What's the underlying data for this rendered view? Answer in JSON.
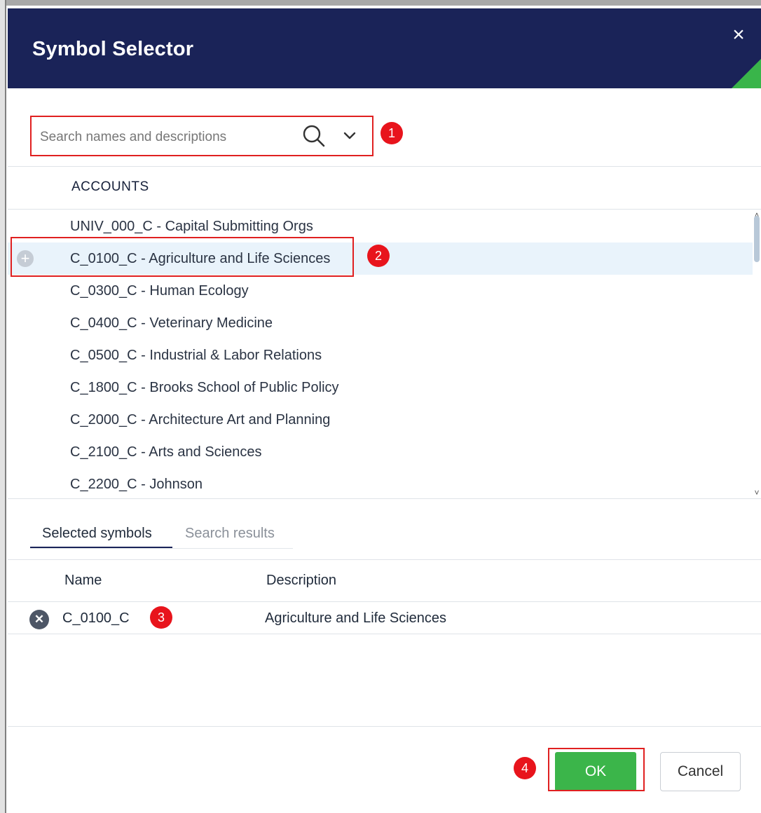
{
  "dialog": {
    "title": "Symbol Selector",
    "close_label": "×"
  },
  "search": {
    "placeholder": "Search names and descriptions",
    "value": "",
    "search_icon": "search-icon",
    "dropdown_icon": "chevron-down-icon"
  },
  "annotations": {
    "step1": "1",
    "step2": "2",
    "step3": "3",
    "step4": "4"
  },
  "symbol_list": {
    "heading": "ACCOUNTS",
    "items": [
      {
        "label": "UNIV_000_C - Capital Submitting Orgs",
        "selected": false
      },
      {
        "label": "C_0100_C - Agriculture and Life Sciences",
        "selected": true
      },
      {
        "label": "C_0300_C - Human Ecology",
        "selected": false
      },
      {
        "label": "C_0400_C - Veterinary Medicine",
        "selected": false
      },
      {
        "label": "C_0500_C - Industrial & Labor Relations",
        "selected": false
      },
      {
        "label": "C_1800_C - Brooks School of Public Policy",
        "selected": false
      },
      {
        "label": "C_2000_C - Architecture Art and Planning",
        "selected": false
      },
      {
        "label": "C_2100_C - Arts and Sciences",
        "selected": false
      },
      {
        "label": "C_2200_C - Johnson",
        "selected": false
      }
    ]
  },
  "tabs": {
    "selected_symbols": "Selected symbols",
    "search_results": "Search results",
    "active": "selected_symbols"
  },
  "selected_table": {
    "columns": {
      "name": "Name",
      "description": "Description"
    },
    "rows": [
      {
        "name": "C_0100_C",
        "description": "Agriculture and Life Sciences"
      }
    ]
  },
  "footer": {
    "ok_label": "OK",
    "cancel_label": "Cancel"
  },
  "colors": {
    "header_bg": "#1a2358",
    "accent_green": "#3bb54a",
    "annotation_red": "#e8141c"
  }
}
